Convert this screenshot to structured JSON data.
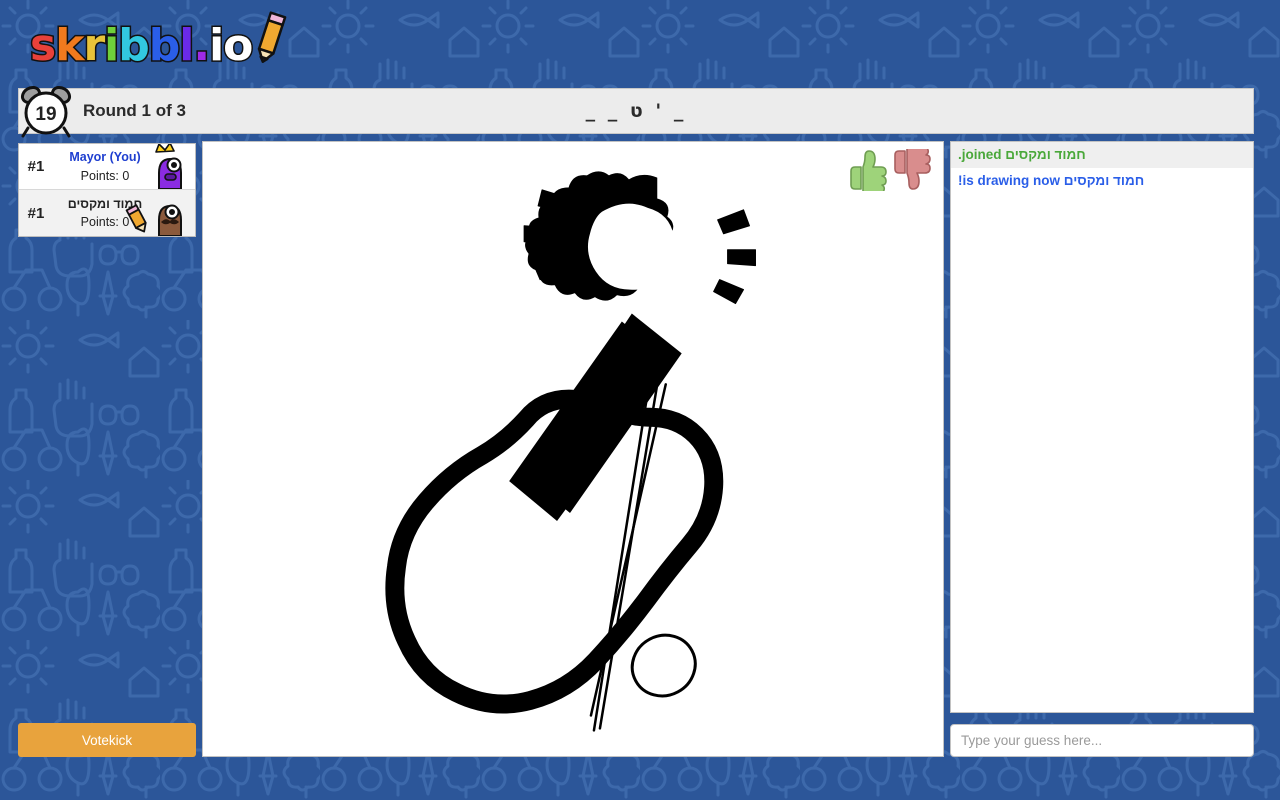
{
  "brand": {
    "name": "skribbl.io",
    "letters": [
      {
        "ch": "s",
        "color": "#e8413a"
      },
      {
        "ch": "k",
        "color": "#f07a1e"
      },
      {
        "ch": "r",
        "color": "#e8c33a"
      },
      {
        "ch": "i",
        "color": "#6fd03a"
      },
      {
        "ch": "b",
        "color": "#32c8e0"
      },
      {
        "ch": "b",
        "color": "#2a5ee8"
      },
      {
        "ch": "l",
        "color": "#6a2ae8"
      },
      {
        "ch": ".",
        "color": "#a02ae8"
      },
      {
        "ch": "i",
        "color": "#ffffff"
      },
      {
        "ch": "o",
        "color": "#ffffff"
      }
    ],
    "pencil_icon": "pencil-icon"
  },
  "topbar": {
    "timer": "19",
    "timer_icon": "alarm-clock-icon",
    "round_label": "Round 1 of 3",
    "word_hint": "_ _ ט ' _"
  },
  "players": {
    "list": [
      {
        "rank": "#1",
        "name": "Mayor (You)",
        "points_label": "Points: 0",
        "is_you": true,
        "is_drawing": false,
        "avatar": {
          "name": "avatar-mayor",
          "body": "#8a2be2",
          "skin": "#9b30ff",
          "crown": true,
          "crown_color": "#ffd11a"
        }
      },
      {
        "rank": "#1",
        "name": "חמוד ומקסים",
        "points_label": "Points: 0",
        "is_you": false,
        "is_drawing": true,
        "avatar": {
          "name": "avatar-hamud",
          "body": "#8b5a3c",
          "skin": "#a0673f",
          "crown": false,
          "crown_color": ""
        }
      }
    ]
  },
  "votekick": {
    "label": "Votekick",
    "color": "#e8a33d"
  },
  "canvas": {
    "name": "drawing-canvas",
    "subject": "guitar",
    "background": "#ffffff",
    "stroke_color": "#000000",
    "vote_up_icon": "thumbs-up-icon",
    "vote_down_icon": "thumbs-down-icon",
    "vote_up_color": "#9ed37a",
    "vote_down_color": "#d98d8d"
  },
  "chat": {
    "messages": [
      {
        "text": "חמוד ומקסים joined.",
        "color": "#4aa83a",
        "alt": true
      },
      {
        "text": "חמוד ומקסים is drawing now!",
        "color": "#2a5ee8",
        "alt": false
      }
    ],
    "input_placeholder": "Type your guess here...",
    "input_value": ""
  },
  "theme": {
    "page_background": "#2c5699",
    "doodle_stroke": "#3f6bae",
    "panel_background": "#ececec",
    "panel_border": "#c2c2c2"
  }
}
